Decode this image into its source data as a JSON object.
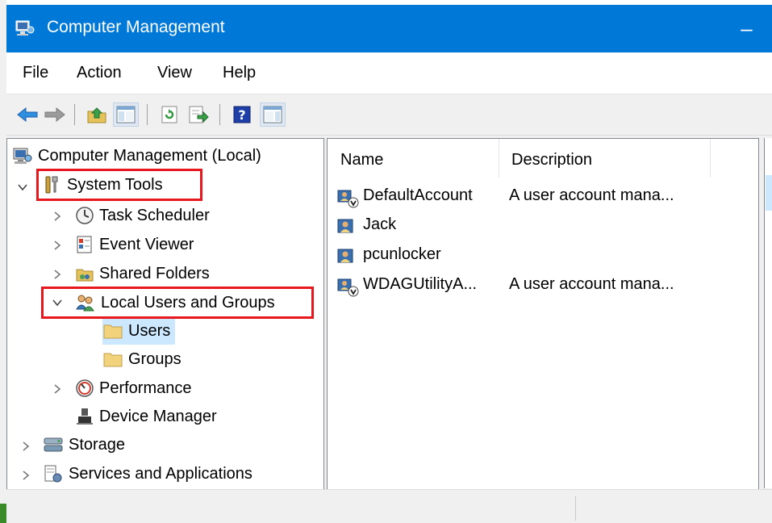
{
  "window": {
    "title": "Computer Management",
    "minimize_glyph": "–",
    "accent_color": "#0078d7"
  },
  "menubar": {
    "items": [
      "File",
      "Action",
      "View",
      "Help"
    ]
  },
  "toolbar": {
    "buttons": [
      "back-icon",
      "forward-icon",
      "up-folder-icon",
      "show-hide-console-tree-icon",
      "refresh-icon",
      "export-list-icon",
      "help-icon",
      "show-hide-action-pane-icon"
    ]
  },
  "tree": {
    "root": "Computer Management (Local)",
    "system_tools": "System Tools",
    "task_scheduler": "Task Scheduler",
    "event_viewer": "Event Viewer",
    "shared_folders": "Shared Folders",
    "local_users_groups": "Local Users and Groups",
    "users": "Users",
    "groups": "Groups",
    "performance": "Performance",
    "device_manager": "Device Manager",
    "storage": "Storage",
    "services_apps": "Services and Applications",
    "selected": "Users",
    "highlight_color": "#e8171d"
  },
  "list": {
    "columns": [
      "Name",
      "Description"
    ],
    "rows": [
      {
        "name": "DefaultAccount",
        "description": "A user account mana...",
        "disabled": true
      },
      {
        "name": "Jack",
        "description": "",
        "disabled": false
      },
      {
        "name": "pcunlocker",
        "description": "",
        "disabled": false
      },
      {
        "name": "WDAGUtilityA...",
        "description": "A user account mana...",
        "disabled": true
      }
    ]
  }
}
